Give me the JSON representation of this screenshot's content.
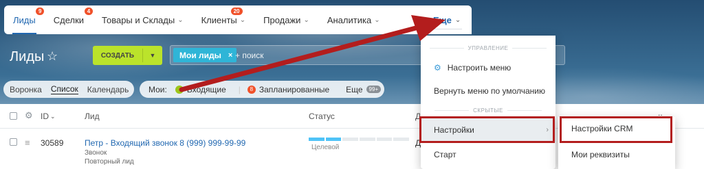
{
  "nav": {
    "items": [
      {
        "label": "Лиды",
        "badge": "9"
      },
      {
        "label": "Сделки",
        "badge": "4"
      },
      {
        "label": "Товары и Склады",
        "badge": ""
      },
      {
        "label": "Клиенты",
        "badge": "20"
      },
      {
        "label": "Продажи",
        "badge": ""
      },
      {
        "label": "Аналитика",
        "badge": ""
      }
    ],
    "more_label": "Еще"
  },
  "page": {
    "title": "Лиды",
    "create_label": "СОЗДАТЬ",
    "filter_chip": "Мои лиды",
    "search_placeholder": "+ поиск"
  },
  "view": {
    "tabs": [
      "Воронка",
      "Список",
      "Календарь"
    ],
    "mine_label": "Мои:",
    "incoming": "Входящие",
    "planned_count": "8",
    "planned": "Запланированные",
    "more": "Еще",
    "more_count": "99+"
  },
  "table": {
    "headers": {
      "id": "ID",
      "lead": "Лид",
      "status": "Статус",
      "col4": "Д",
      "col5": ".."
    },
    "row": {
      "id": "30589",
      "title": "Петр - Входящий звонок 8 (999) 999-99-99",
      "sub1": "Звонок",
      "sub2": "Повторный лид",
      "status": "Целевой",
      "col4": "Д"
    }
  },
  "menu": {
    "section_manage": "УПРАВЛЕНИЕ",
    "configure": "Настроить меню",
    "reset": "Вернуть меню по умолчанию",
    "section_hidden": "СКРЫТЫЕ",
    "settings": "Настройки",
    "start": "Старт"
  },
  "submenu": {
    "crm_settings": "Настройки CRM",
    "requisites": "Мои реквизиты"
  },
  "colors": {
    "accent": "#2067b0",
    "create": "#bbe32b",
    "badge": "#f0512a",
    "highlight": "#b31d1d"
  }
}
